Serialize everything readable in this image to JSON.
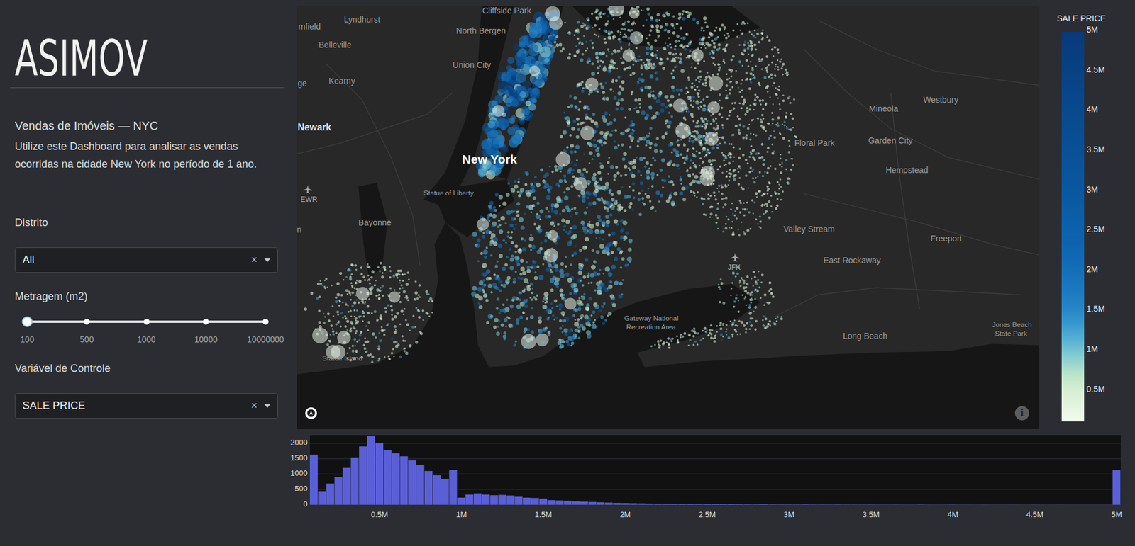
{
  "sidebar": {
    "logo": "ASIMOV",
    "title": "Vendas de Imóveis — NYC",
    "description": "Utilize este Dashboard para analisar as vendas ocorridas na cidade New York no período de 1 ano.",
    "controls": [
      {
        "kind": "dropdown",
        "label": "Distrito",
        "value": "All",
        "clear": "×"
      },
      {
        "kind": "slider",
        "label": "Metragem (m2)",
        "level": 0,
        "marks": [
          "100",
          "500",
          "1000",
          "10000",
          "10000000"
        ]
      },
      {
        "kind": "dropdown",
        "label": "Variável de Controle",
        "value": "SALE PRICE",
        "clear": "×"
      }
    ]
  },
  "map": {
    "info": "i",
    "labels": [
      {
        "text": "Cliffside Park",
        "kind": "town"
      },
      {
        "text": "mfield",
        "kind": "town"
      },
      {
        "text": "Lyndhurst",
        "kind": "town"
      },
      {
        "text": "North Bergen",
        "kind": "town"
      },
      {
        "text": "Belleville",
        "kind": "town"
      },
      {
        "text": "Union City",
        "kind": "town"
      },
      {
        "text": "ge",
        "kind": "town"
      },
      {
        "text": "Kearny",
        "kind": "town"
      },
      {
        "text": "Newark",
        "kind": "major"
      },
      {
        "text": "New York",
        "kind": "city"
      },
      {
        "text": "EWR",
        "kind": "airport"
      },
      {
        "text": "Statue of Liberty",
        "kind": "park"
      },
      {
        "text": "Bayonne",
        "kind": "town"
      },
      {
        "text": "n",
        "kind": "town"
      },
      {
        "text": "Staten Island",
        "kind": "park"
      },
      {
        "text": "Gateway National",
        "kind": "park"
      },
      {
        "text": "Recreation Area",
        "kind": "park"
      },
      {
        "text": "JFK",
        "kind": "airport"
      },
      {
        "text": "Floral Park",
        "kind": "town"
      },
      {
        "text": "Mineola",
        "kind": "town"
      },
      {
        "text": "Westbury",
        "kind": "town"
      },
      {
        "text": "Garden City",
        "kind": "town"
      },
      {
        "text": "Hempstead",
        "kind": "town"
      },
      {
        "text": "Valley Stream",
        "kind": "town"
      },
      {
        "text": "Freeport",
        "kind": "town"
      },
      {
        "text": "East Rockaway",
        "kind": "town"
      },
      {
        "text": "Long Beach",
        "kind": "town"
      },
      {
        "text": "Jones Beach",
        "kind": "park"
      },
      {
        "text": "State Park",
        "kind": "park"
      }
    ]
  },
  "colorbar": {
    "title": "SALE PRICE",
    "ticks": [
      "5M",
      "4.5M",
      "4M",
      "3.5M",
      "3M",
      "2.5M",
      "2M",
      "1.5M",
      "1M",
      "0.5M"
    ]
  },
  "histogram": {
    "y_ticks": [
      "2000",
      "1500",
      "1000",
      "500",
      "0"
    ],
    "x_ticks": [
      "0.5M",
      "1M",
      "1.5M",
      "2M",
      "2.5M",
      "3M",
      "3.5M",
      "4M",
      "4.5M",
      "5M"
    ],
    "values": [
      1630,
      420,
      690,
      900,
      1200,
      1520,
      1900,
      2230,
      2000,
      1780,
      1680,
      1580,
      1450,
      1300,
      1100,
      960,
      840,
      1130,
      230,
      330,
      370,
      330,
      310,
      320,
      300,
      260,
      230,
      220,
      200,
      150,
      140,
      130,
      110,
      100,
      90,
      80,
      70,
      60,
      55,
      50,
      45,
      40,
      38,
      35,
      30,
      28,
      25,
      30,
      22,
      20,
      18,
      20,
      16,
      15,
      14,
      18,
      13,
      12,
      12,
      11,
      14,
      10,
      10,
      9,
      12,
      9,
      8,
      8,
      10,
      7,
      7,
      8,
      6,
      6,
      9,
      6,
      5,
      5,
      8,
      5,
      5,
      4,
      6,
      4,
      4,
      5,
      4,
      3,
      5,
      3,
      3,
      4,
      3,
      3,
      3,
      3,
      3,
      3,
      1130
    ]
  }
}
